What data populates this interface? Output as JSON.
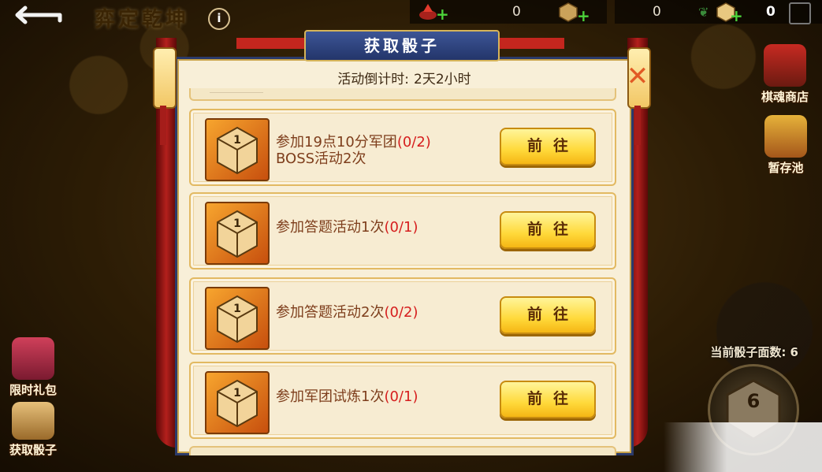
{
  "topbar": {
    "game_title": "弈定乾坤",
    "info_icon": "info-icon",
    "resources": [
      {
        "icon": "red-crystal-icon",
        "value": "0"
      },
      {
        "icon": "dice-icon",
        "value": "0"
      },
      {
        "icon": "dice-icon",
        "value": "0"
      }
    ]
  },
  "sidebar_right": {
    "shop_label": "棋魂商店",
    "storage_label": "暂存池"
  },
  "sidebar_left": {
    "gift_label": "限时礼包",
    "get_dice_label": "获取骰子"
  },
  "dice_count_label": "当前骰子面数: 6",
  "dice_big_face": "6",
  "modal": {
    "title": "获取骰子",
    "countdown_label": "活动倒计时:",
    "countdown_value": "2天2小时",
    "close_glyph": "✕",
    "tasks": [
      {
        "text_line1": "参加19点10分军团",
        "progress": "(0/2)",
        "text_line2": "BOSS活动2次",
        "button": "前往",
        "dice_face": "1"
      },
      {
        "text_line1": "参加答题活动1次",
        "progress": "(0/1)",
        "text_line2": "",
        "button": "前往",
        "dice_face": "1"
      },
      {
        "text_line1": "参加答题活动2次",
        "progress": "(0/2)",
        "text_line2": "",
        "button": "前往",
        "dice_face": "1"
      },
      {
        "text_line1": "参加军团试炼1次",
        "progress": "(0/1)",
        "text_line2": "",
        "button": "前往",
        "dice_face": "1"
      }
    ]
  },
  "colors": {
    "modal_bg": "#f8efd8",
    "title_plate": "#2b3a6a",
    "task_text": "#7e3e1c",
    "progress": "#d61e1e",
    "button_gold": "#ffd93a"
  }
}
